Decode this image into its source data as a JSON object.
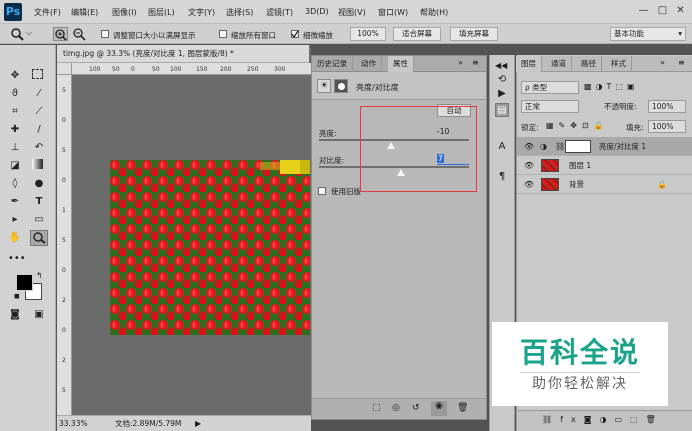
{
  "app": {
    "logo": "Ps"
  },
  "menu": [
    "文件(F)",
    "编辑(E)",
    "图像(I)",
    "图层(L)",
    "文字(Y)",
    "选择(S)",
    "滤镜(T)",
    "3D(D)",
    "视图(V)",
    "窗口(W)",
    "帮助(H)"
  ],
  "window_controls": [
    "—",
    "□",
    "✕"
  ],
  "options_bar": {
    "zoom_arrow": "⌵",
    "resize_windows": "调整窗口大小以满屏显示",
    "zoom_all": "缩放所有窗口",
    "scrubby_zoom": "细微缩放",
    "zoom_value": "100%",
    "fit_screen": "适合屏幕",
    "fill_screen": "填充屏幕",
    "workspace": "基本功能"
  },
  "document": {
    "tab_title": "timg.jpg @ 33.3% (亮度/对比度 1, 图层蒙版/8) *",
    "ruler_h": [
      "100",
      "50",
      "0",
      "50",
      "100",
      "150",
      "200",
      "250",
      "300"
    ],
    "ruler_v": [
      "5",
      "0",
      "5",
      "0",
      "1",
      "5",
      "0",
      "2",
      "0",
      "2",
      "5"
    ],
    "zoom": "33.33%",
    "doc_size": "文档:2.89M/5.79M"
  },
  "properties_panel": {
    "tabs": [
      "历史记录",
      "动作",
      "属性"
    ],
    "active_tab": "属性",
    "adjustment_title": "亮度/对比度",
    "auto_button": "自动",
    "brightness_label": "亮度:",
    "brightness_value": "-10",
    "brightness_fraction": 0.4833,
    "contrast_label": "对比度:",
    "contrast_value": "7",
    "contrast_fraction": 0.5467,
    "legacy_label": "使用旧版"
  },
  "layers_panel": {
    "tabs": [
      "图层",
      "通道",
      "路径",
      "样式"
    ],
    "filter_kind": "ρ 类型",
    "blend_mode": "正常",
    "opacity_label": "不透明度:",
    "opacity_value": "100%",
    "lock_label": "锁定:",
    "fill_label": "填充:",
    "fill_value": "100%",
    "layers": [
      {
        "name": "亮度/对比度 1",
        "type": "adjustment",
        "selected": true
      },
      {
        "name": "图层 1",
        "type": "image",
        "selected": false
      },
      {
        "name": "背景",
        "type": "background",
        "selected": false
      }
    ]
  },
  "watermark": {
    "title": "百科全说",
    "subtitle": "助你轻松解决"
  },
  "colors": {
    "accent": "#1aa38a",
    "highlight_box": "#e23c3c",
    "tulip_red": "#e1141c"
  }
}
